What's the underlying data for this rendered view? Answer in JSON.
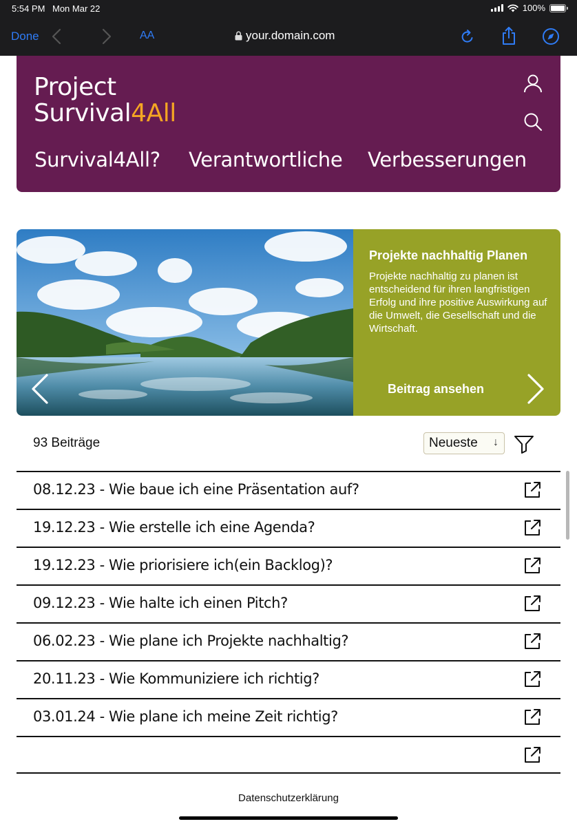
{
  "status": {
    "time": "5:54 PM",
    "date": "Mon Mar 22",
    "battery": "100%",
    "battery_level": 1.0
  },
  "browser": {
    "done_label": "Done",
    "text_size_label": "AA",
    "url": "your.domain.com"
  },
  "site": {
    "logo_line1": "Project",
    "logo_line2_main": "Survival",
    "logo_line2_accent": "4All",
    "brand_color": "#651c51",
    "accent_color": "#f5a623",
    "nav": [
      "Survival4All?",
      "Verantwortliche",
      "Verbesserungen"
    ],
    "icons": [
      "user-icon",
      "search-icon"
    ]
  },
  "hero": {
    "title": "Projekte nachhaltig Planen",
    "text": "Projekte nachhaltig zu planen ist entscheidend für ihren langfristigen Erfolg und ihre positive Auswirkung auf die Umwelt, die Gesellschaft und die Wirtschaft.",
    "link": "Beitrag ansehen",
    "panel_color": "#97a227"
  },
  "list": {
    "count": "93 Beiträge",
    "sort_value": "Neueste",
    "posts": [
      "08.12.23 - Wie baue ich eine Präsentation auf?",
      "19.12.23 - Wie erstelle ich eine Agenda?",
      "19.12.23 - Wie priorisiere ich(ein Backlog)?",
      "09.12.23 - Wie halte ich einen Pitch?",
      "06.02.23 - Wie plane ich Projekte nachhaltig?",
      "20.11.23 - Wie Kommuniziere ich richtig?",
      "03.01.24 - Wie plane ich meine Zeit richtig?",
      ""
    ]
  },
  "footer": {
    "privacy": "Datenschutzerklärung"
  }
}
